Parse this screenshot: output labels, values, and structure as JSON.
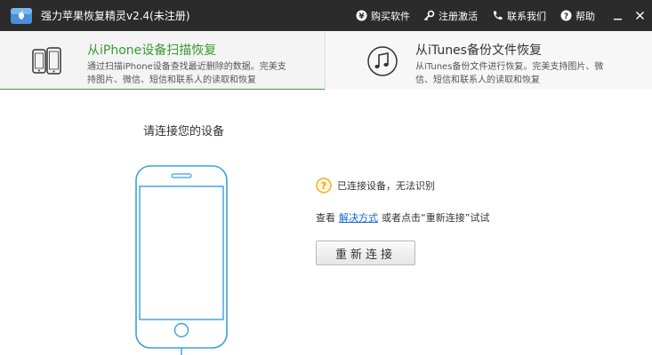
{
  "window": {
    "title": "强力苹果恢复精灵v2.4(未注册)"
  },
  "top_menu": {
    "buy": "购买软件",
    "register": "注册激活",
    "contact": "联系我们",
    "help": "帮助"
  },
  "tabs": [
    {
      "title": "从iPhone设备扫描恢复",
      "desc": "通过扫描iPhone设备查找最近删除的数据。完美支持图片、微信、短信和联系人的读取和恢复",
      "icon": "phones-icon"
    },
    {
      "title": "从iTunes备份文件恢复",
      "desc": "从iTunes备份文件进行恢复。完美支持图片、微信、短信和联系人的读取和恢复",
      "icon": "music-note-icon"
    }
  ],
  "main": {
    "section_title": "请连接您的设备",
    "status_text": "已连接设备，无法识别",
    "hint_prefix": "查看",
    "hint_link": "解决方式",
    "hint_suffix": "或者点击“重新连接”试试",
    "reconnect_label": "重新连接"
  },
  "colors": {
    "titlebar": "#2b2b2b",
    "accent_green": "#3aa23a",
    "link_blue": "#1a66cc",
    "phone_outline": "#3aa0e0",
    "warning_yellow": "#f0b020"
  }
}
